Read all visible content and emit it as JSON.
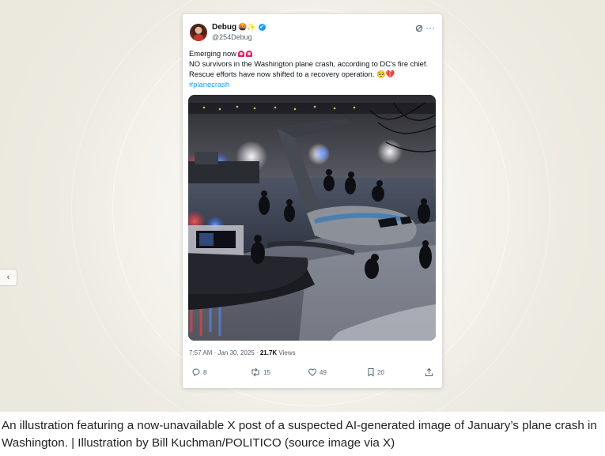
{
  "post": {
    "display_name": "Debug",
    "name_badges": "🤬✨",
    "handle": "@254Debug",
    "text_line1": "Emerging now",
    "text_line2": "NO survivors in the Washington plane crash, according to DC's fire chief.",
    "text_line3": "Rescue efforts have now shifted to a recovery operation.",
    "text_line3_emoji": "🥺💔",
    "hashtag": "#planecrash",
    "time": "7:57 AM · Jan 30, 2025 · ",
    "views_count": "21.7K",
    "views_label": " Views",
    "replies": "8",
    "reposts": "15",
    "likes": "49",
    "bookmarks": "20"
  },
  "icons": [
    "grok-icon",
    "more-icon",
    "reply-icon",
    "repost-icon",
    "like-icon",
    "bookmark-icon",
    "share-icon",
    "verified-badge-icon",
    "siren-icon"
  ],
  "colors": {
    "link": "#1d9bf0",
    "text": "#0f1419",
    "muted": "#536471",
    "background": "#ebe8de"
  },
  "sidebar_toggle": "‹",
  "caption": "An illustration featuring a now-unavailable X post of a suspected AI-generated image of January’s plane crash in Washington. | Illustration by Bill Kuchman/POLITICO (source image via X)"
}
